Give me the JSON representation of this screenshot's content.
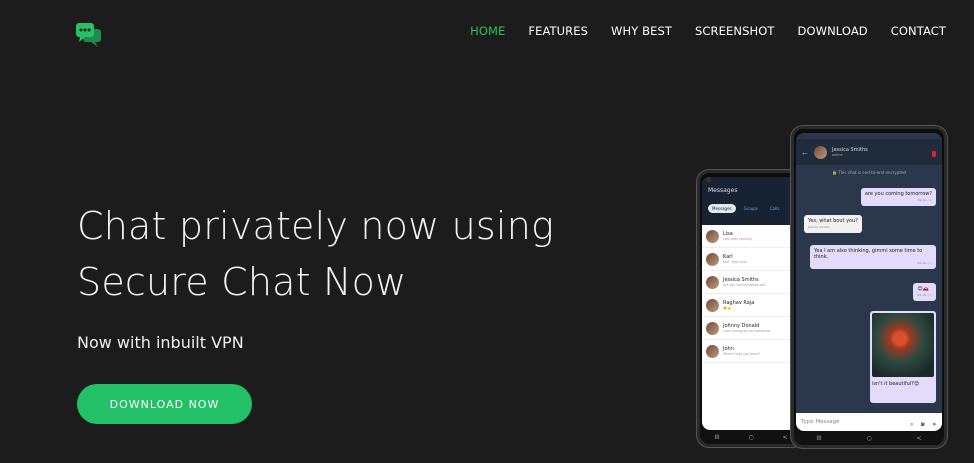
{
  "colors": {
    "accent": "#23c167",
    "background": "#1c1c1c"
  },
  "logo": {
    "icon": "chat-bubbles-icon"
  },
  "nav": {
    "items": [
      {
        "label": "HOME"
      },
      {
        "label": "FEATURES"
      },
      {
        "label": "WHY BEST"
      },
      {
        "label": "SCREENSHOT"
      },
      {
        "label": "DOWNLOAD"
      },
      {
        "label": "CONTACT"
      }
    ],
    "active_label": "HOME"
  },
  "hero": {
    "title_line1": "Chat privately now using",
    "title_line2": "Secure Chat Now",
    "subtitle": "Now with inbuilt VPN",
    "cta_label": "DOWNLOAD NOW"
  },
  "phone_left": {
    "header_title": "Messages",
    "tabs": [
      "Messages",
      "Groups",
      "Calls"
    ],
    "chats": [
      {
        "name": "Lisa",
        "message": "Last seen recently"
      },
      {
        "name": "Karl",
        "message": "Karl: Type here"
      },
      {
        "name": "Jessica Smiths",
        "message": "Are you coming tomorrow?"
      },
      {
        "name": "Raghav Raja",
        "message": "☺️👍"
      },
      {
        "name": "Johnny Donald",
        "message": "I am coming to you tomorrow"
      },
      {
        "name": "John",
        "message": "Where have you been?"
      }
    ],
    "navbar": [
      "III",
      "○",
      "<"
    ]
  },
  "phone_right": {
    "contact_name": "Jessica Smiths",
    "contact_status": "online",
    "encryption_note": "🔒 This chat is end-to-end encrypted",
    "messages": [
      {
        "from": "me",
        "text": "are you coming tomorrow?",
        "time": "09:14 ✓✓"
      },
      {
        "from": "them",
        "text": "Yes, what bout you?",
        "time": "Jessica Smiths"
      },
      {
        "from": "me",
        "text": "Yea I am also thinking, gimmi some time to think.",
        "time": "09:16 ✓✓"
      },
      {
        "from": "me",
        "text": "😊🚗",
        "time": "09:16 ✓✓"
      },
      {
        "from": "me",
        "text": "isn't it beautiful?😍",
        "time": "09:16 ✓✓"
      }
    ],
    "input_placeholder": "Type Message",
    "navbar": [
      "III",
      "○",
      "<"
    ]
  }
}
